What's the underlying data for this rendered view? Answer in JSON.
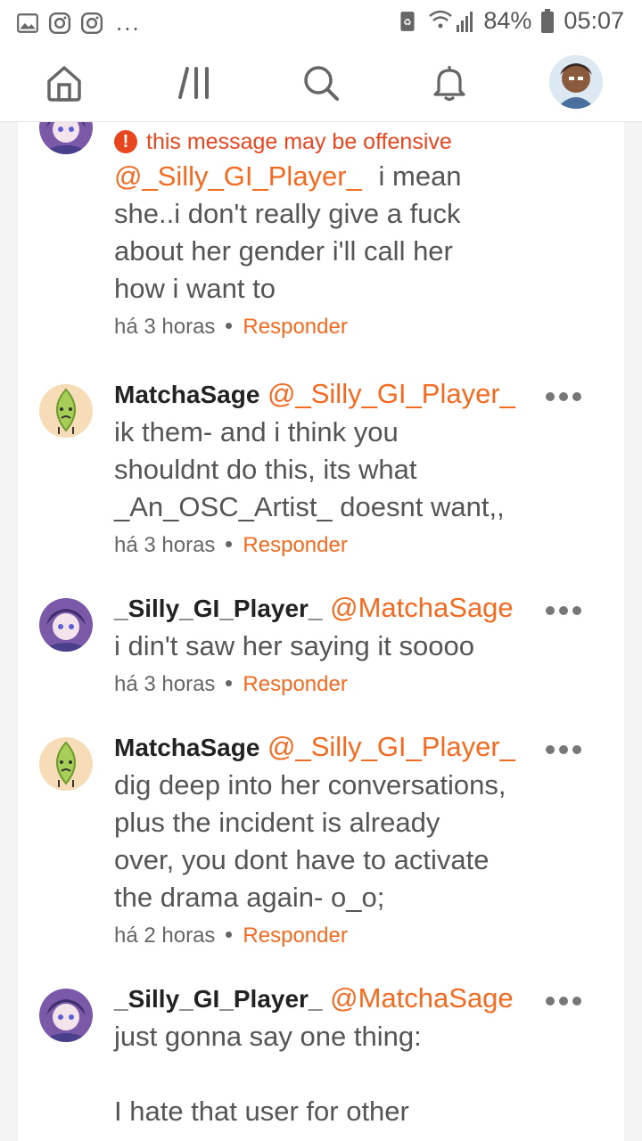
{
  "status_bar": {
    "left_icons": [
      "gallery-icon",
      "instagram-icon",
      "instagram-icon"
    ],
    "overflow": "...",
    "battery_percent": "84%",
    "time": "05:07"
  },
  "nav": {
    "items": [
      "home-icon",
      "feed-icon",
      "search-icon",
      "bell-icon",
      "profile-avatar"
    ]
  },
  "comments": [
    {
      "warning": "this message may be offensive",
      "mention": "@_Silly_GI_Player_",
      "lines": [
        "i mean",
        "she..i don't really give a fuck",
        "about her gender i'll call her",
        "how i want to"
      ],
      "time": "há 3 horas",
      "reply": "Responder"
    },
    {
      "username": "MatchaSage",
      "mention": "@_Silly_GI_Player_",
      "lines": [
        "ik them- and i think you",
        "shouldnt do this, its what",
        "_An_OSC_Artist_ doesnt want,,"
      ],
      "time": "há 3 horas",
      "reply": "Responder"
    },
    {
      "username": "_Silly_GI_Player_",
      "mention": "@MatchaSage",
      "lines": [
        "i din't saw her saying it soooo"
      ],
      "time": "há 3 horas",
      "reply": "Responder"
    },
    {
      "username": "MatchaSage",
      "mention": "@_Silly_GI_Player_",
      "lines": [
        "dig deep into her conversations,",
        "plus the incident is already",
        "over, you dont have to activate",
        "the drama again- o_o;"
      ],
      "time": "há 2 horas",
      "reply": "Responder"
    },
    {
      "username": "_Silly_GI_Player_",
      "mention": "@MatchaSage",
      "lines": [
        "just gonna say one thing:",
        "",
        "I hate that user for other"
      ],
      "time": "",
      "reply": ""
    }
  ],
  "colors": {
    "accent": "#f26b21",
    "warning": "#e8461f"
  }
}
